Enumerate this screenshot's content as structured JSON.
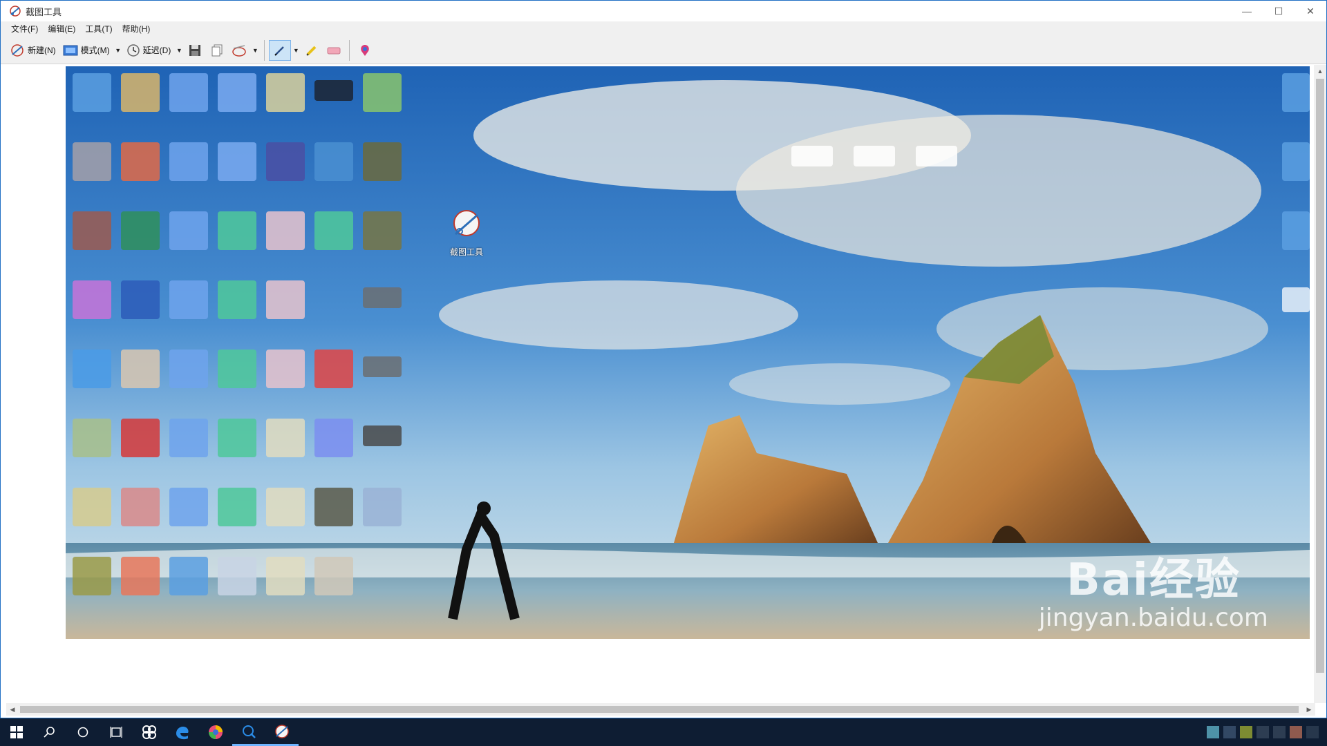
{
  "window": {
    "title": "截图工具",
    "controls": {
      "minimize": "—",
      "maximize": "☐",
      "close": "✕"
    }
  },
  "menu": {
    "items": [
      "文件(F)",
      "编辑(E)",
      "工具(T)",
      "帮助(H)"
    ]
  },
  "toolbar": {
    "new_label": "新建(N)",
    "mode_label": "模式(M)",
    "delay_label": "延迟(D)",
    "dropdown_glyph": "▼"
  },
  "desktop": {
    "shortcut_label": "截图工具"
  },
  "watermark": {
    "line1": "Bai经验",
    "line2": "jingyan.baidu.com"
  },
  "colors": {
    "accent": "#1f6fc4",
    "taskbar": "#0e1d33",
    "pen_active": "#cce4f7"
  },
  "icons": {
    "app": "scissors-icon",
    "save": "save-icon",
    "copy": "copy-icon",
    "send": "send-icon",
    "pen": "pen-icon",
    "highlighter": "highlighter-icon",
    "eraser": "eraser-icon",
    "paint3d": "paint3d-icon"
  }
}
